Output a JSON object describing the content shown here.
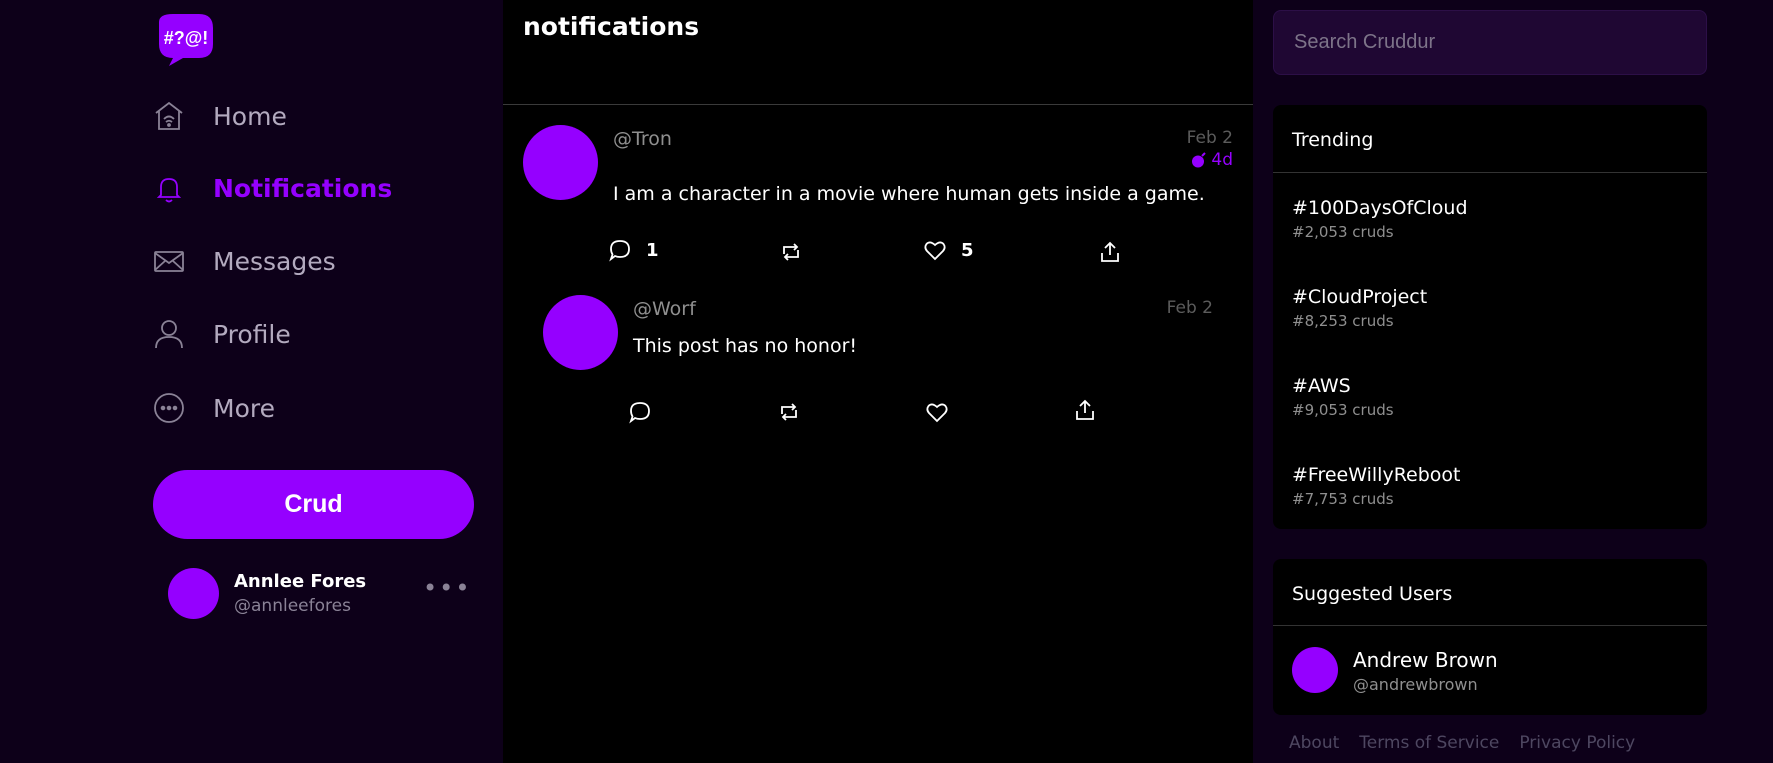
{
  "app": {
    "logo_text": "#?@!"
  },
  "nav": {
    "items": [
      {
        "label": "Home",
        "icon": "home-icon"
      },
      {
        "label": "Notifications",
        "icon": "bell-icon",
        "active": true
      },
      {
        "label": "Messages",
        "icon": "mail-icon"
      },
      {
        "label": "Profile",
        "icon": "user-icon"
      },
      {
        "label": "More",
        "icon": "more-circle-icon"
      }
    ],
    "crud_button": "Crud",
    "profile": {
      "name": "Annlee Fores",
      "handle": "@annleefores",
      "more": "•••"
    }
  },
  "feed": {
    "title": "notifications",
    "posts": [
      {
        "handle": "@Tron",
        "date": "Feb 2",
        "expires": "4d",
        "body": "I am a character in a movie where human gets inside a game.",
        "reply_count": "1",
        "like_count": "5"
      },
      {
        "handle": "@Worf",
        "date": "Feb 2",
        "body": "This post has no honor!"
      }
    ]
  },
  "sidebar": {
    "search_placeholder": "Search Cruddur",
    "trending_title": "Trending",
    "trends": [
      {
        "tag": "#100DaysOfCloud",
        "count": "#2,053 cruds"
      },
      {
        "tag": "#CloudProject",
        "count": "#8,253 cruds"
      },
      {
        "tag": "#AWS",
        "count": "#9,053 cruds"
      },
      {
        "tag": "#FreeWillyReboot",
        "count": "#7,753 cruds"
      }
    ],
    "suggested_title": "Suggested Users",
    "suggested": [
      {
        "name": "Andrew Brown",
        "handle": "@andrewbrown"
      }
    ],
    "footer": [
      "About",
      "Terms of Service",
      "Privacy Policy"
    ]
  },
  "colors": {
    "accent": "#9500ff",
    "background": "#0d0019",
    "panel": "#000000"
  }
}
